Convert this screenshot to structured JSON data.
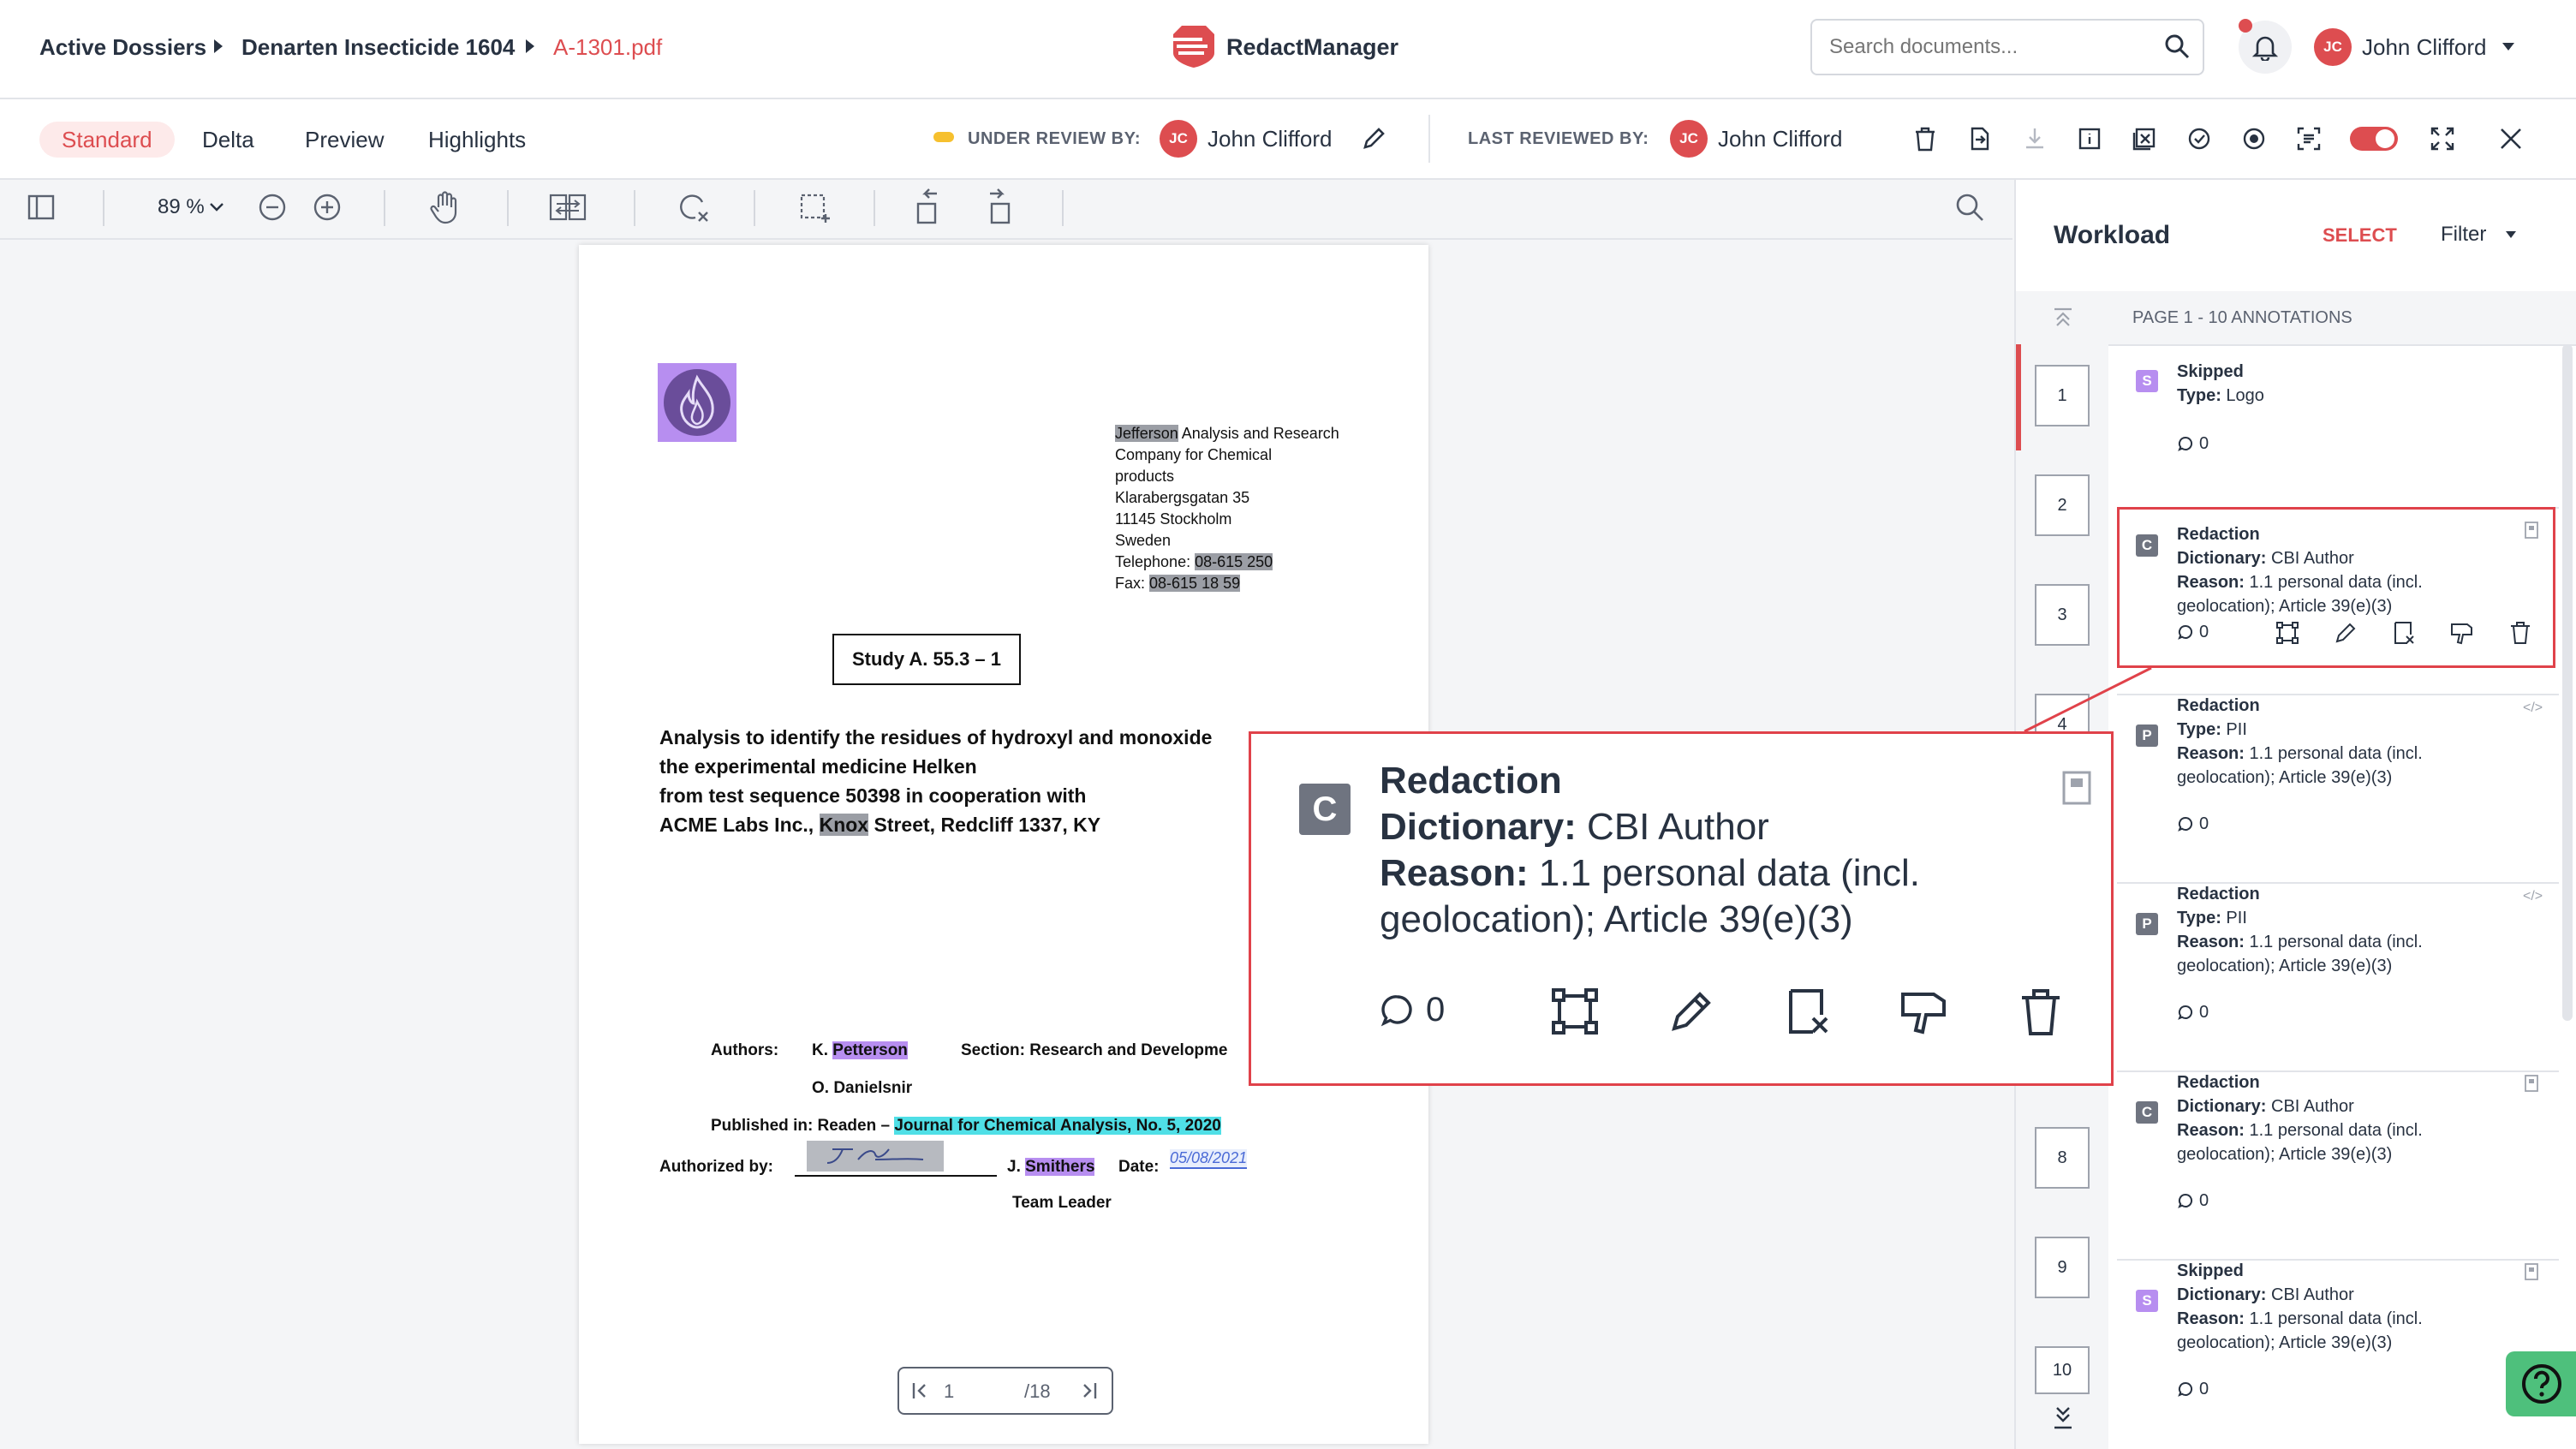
{
  "breadcrumb": {
    "item1": "Active Dossiers",
    "item2": "Denarten Insecticide 1604",
    "item3": "A-1301.pdf"
  },
  "app": {
    "name": "RedactManager"
  },
  "search": {
    "placeholder": "Search documents..."
  },
  "user": {
    "initials": "JC",
    "name": "John Clifford"
  },
  "tabs": {
    "standard": "Standard",
    "delta": "Delta",
    "preview": "Preview",
    "highlights": "Highlights"
  },
  "review": {
    "under_label": "UNDER REVIEW BY:",
    "under_name": "John Clifford",
    "last_label": "LAST REVIEWED BY:",
    "last_name": "John Clifford"
  },
  "viewer": {
    "zoom": "89 %",
    "page_current": "1",
    "page_total": "/18"
  },
  "document": {
    "company_hl": "Jefferson",
    "company_rest": " Analysis and Research",
    "addr2": "Company for Chemical",
    "addr3": "products",
    "addr4": "Klarabergsgatan 35",
    "addr5": "11145 Stockholm",
    "addr6": "Sweden",
    "tel_label": "Telephone: ",
    "tel_val": "08-615 250",
    "fax_label": "Fax: ",
    "fax_val": "08-615 18 59",
    "study": "Study A. 55.3 – 1",
    "title1": "Analysis to identify the residues of hydroxyl and monoxide",
    "title2": "the experimental medicine Helken",
    "title3": "from test sequence 50398 in cooperation with",
    "title4a": "ACME Labs Inc., ",
    "title4hl": "Knox",
    "title4b": " Street, Redcliff 1337, KY",
    "authors_label": "Authors:",
    "author1a": "K. ",
    "author1hl": "Petterson",
    "section": "Section: Research and Developme",
    "author2": "O. Danielsnir",
    "published_label": "Published in: Readen – ",
    "journal": "Journal for Chemical Analysis, No. 5, 2020",
    "authorized_label": "Authorized by:",
    "signature": "J.Smithers",
    "signer_a": "J. ",
    "signer_hl": "Smithers",
    "date_label": "Date:",
    "date_val": "05/08/2021",
    "team": "Team Leader"
  },
  "workload": {
    "title": "Workload",
    "select": "SELECT",
    "filter": "Filter",
    "page_header": "PAGE 1 - 10 ANNOTATIONS",
    "pages": [
      "1",
      "2",
      "3",
      "4",
      "8",
      "9",
      "10"
    ],
    "annotations": [
      {
        "badge": "S",
        "title": "Skipped",
        "l1_label": "Type:",
        "l1_val": " Logo",
        "l2_label": "",
        "l2_val": "",
        "l3": "",
        "comments": "0"
      },
      {
        "badge": "C",
        "title": "Redaction",
        "l1_label": "Dictionary:",
        "l1_val": " CBI Author",
        "l2_label": "Reason:",
        "l2_val": " 1.1 personal data (incl.",
        "l3": "geolocation); Article 39(e)(3)",
        "comments": "0"
      },
      {
        "badge": "P",
        "title": "Redaction",
        "l1_label": "Type:",
        "l1_val": " PII",
        "l2_label": "Reason:",
        "l2_val": " 1.1 personal data (incl.",
        "l3": "geolocation); Article 39(e)(3)",
        "comments": "0"
      },
      {
        "badge": "P",
        "title": "Redaction",
        "l1_label": "Type:",
        "l1_val": " PII",
        "l2_label": "Reason:",
        "l2_val": " 1.1 personal data (incl.",
        "l3": "geolocation); Article 39(e)(3)",
        "comments": "0"
      },
      {
        "badge": "C",
        "title": "Redaction",
        "l1_label": "Dictionary:",
        "l1_val": " CBI Author",
        "l2_label": "Reason:",
        "l2_val": " 1.1 personal data (incl.",
        "l3": "geolocation); Article 39(e)(3)",
        "comments": "0"
      },
      {
        "badge": "S",
        "title": "Skipped",
        "l1_label": "Dictionary:",
        "l1_val": " CBI Author",
        "l2_label": "Reason:",
        "l2_val": " 1.1 personal data (incl.",
        "l3": "geolocation); Article 39(e)(3)",
        "comments": "0"
      }
    ]
  },
  "popup": {
    "badge": "C",
    "title": "Redaction",
    "l1_label": "Dictionary:",
    "l1_val": " CBI Author",
    "l2_label": "Reason:",
    "l2_val": " 1.1 personal data (incl.",
    "l3": "geolocation); Article 39(e)(3)",
    "comments": "0"
  },
  "colors": {
    "accent": "#dd4d50",
    "skipped": "#b78ef0",
    "redaction_gray": "#9b9ea5",
    "journal_cyan": "#4fdfe6",
    "status_yellow": "#f6c02e"
  }
}
